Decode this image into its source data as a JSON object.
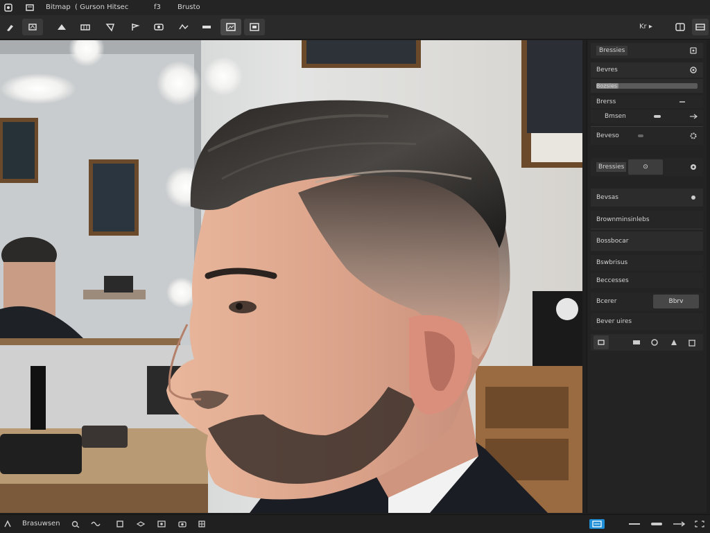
{
  "menubar": {
    "items": [
      "Bitmap",
      "( Gurson Hitsec",
      "f3",
      "Brusto"
    ]
  },
  "toolbar": {
    "right_label": "Kr ▸"
  },
  "panel": {
    "header_label": "Bressies",
    "rows": [
      {
        "label": "Bevres"
      },
      {
        "label": "Bozsies",
        "slider_fraction": 0.22
      },
      {
        "label": "Brerss"
      },
      {
        "label": "Bmsen"
      },
      {
        "label": "Beveso"
      },
      {
        "label": "Bressies",
        "value": "⊙"
      },
      {
        "label": "Bevsas"
      },
      {
        "label": "Brownminsinlebs"
      },
      {
        "label": "Bossbocar"
      },
      {
        "label": "Bswbrisus"
      },
      {
        "label": "Beccesses"
      },
      {
        "label": "Bcerer",
        "value": "Bbrv"
      },
      {
        "label": "Bever uires"
      }
    ]
  },
  "statusbar": {
    "label": "Brasuwsen"
  },
  "icons": {
    "accent": "#1e8fd6"
  }
}
